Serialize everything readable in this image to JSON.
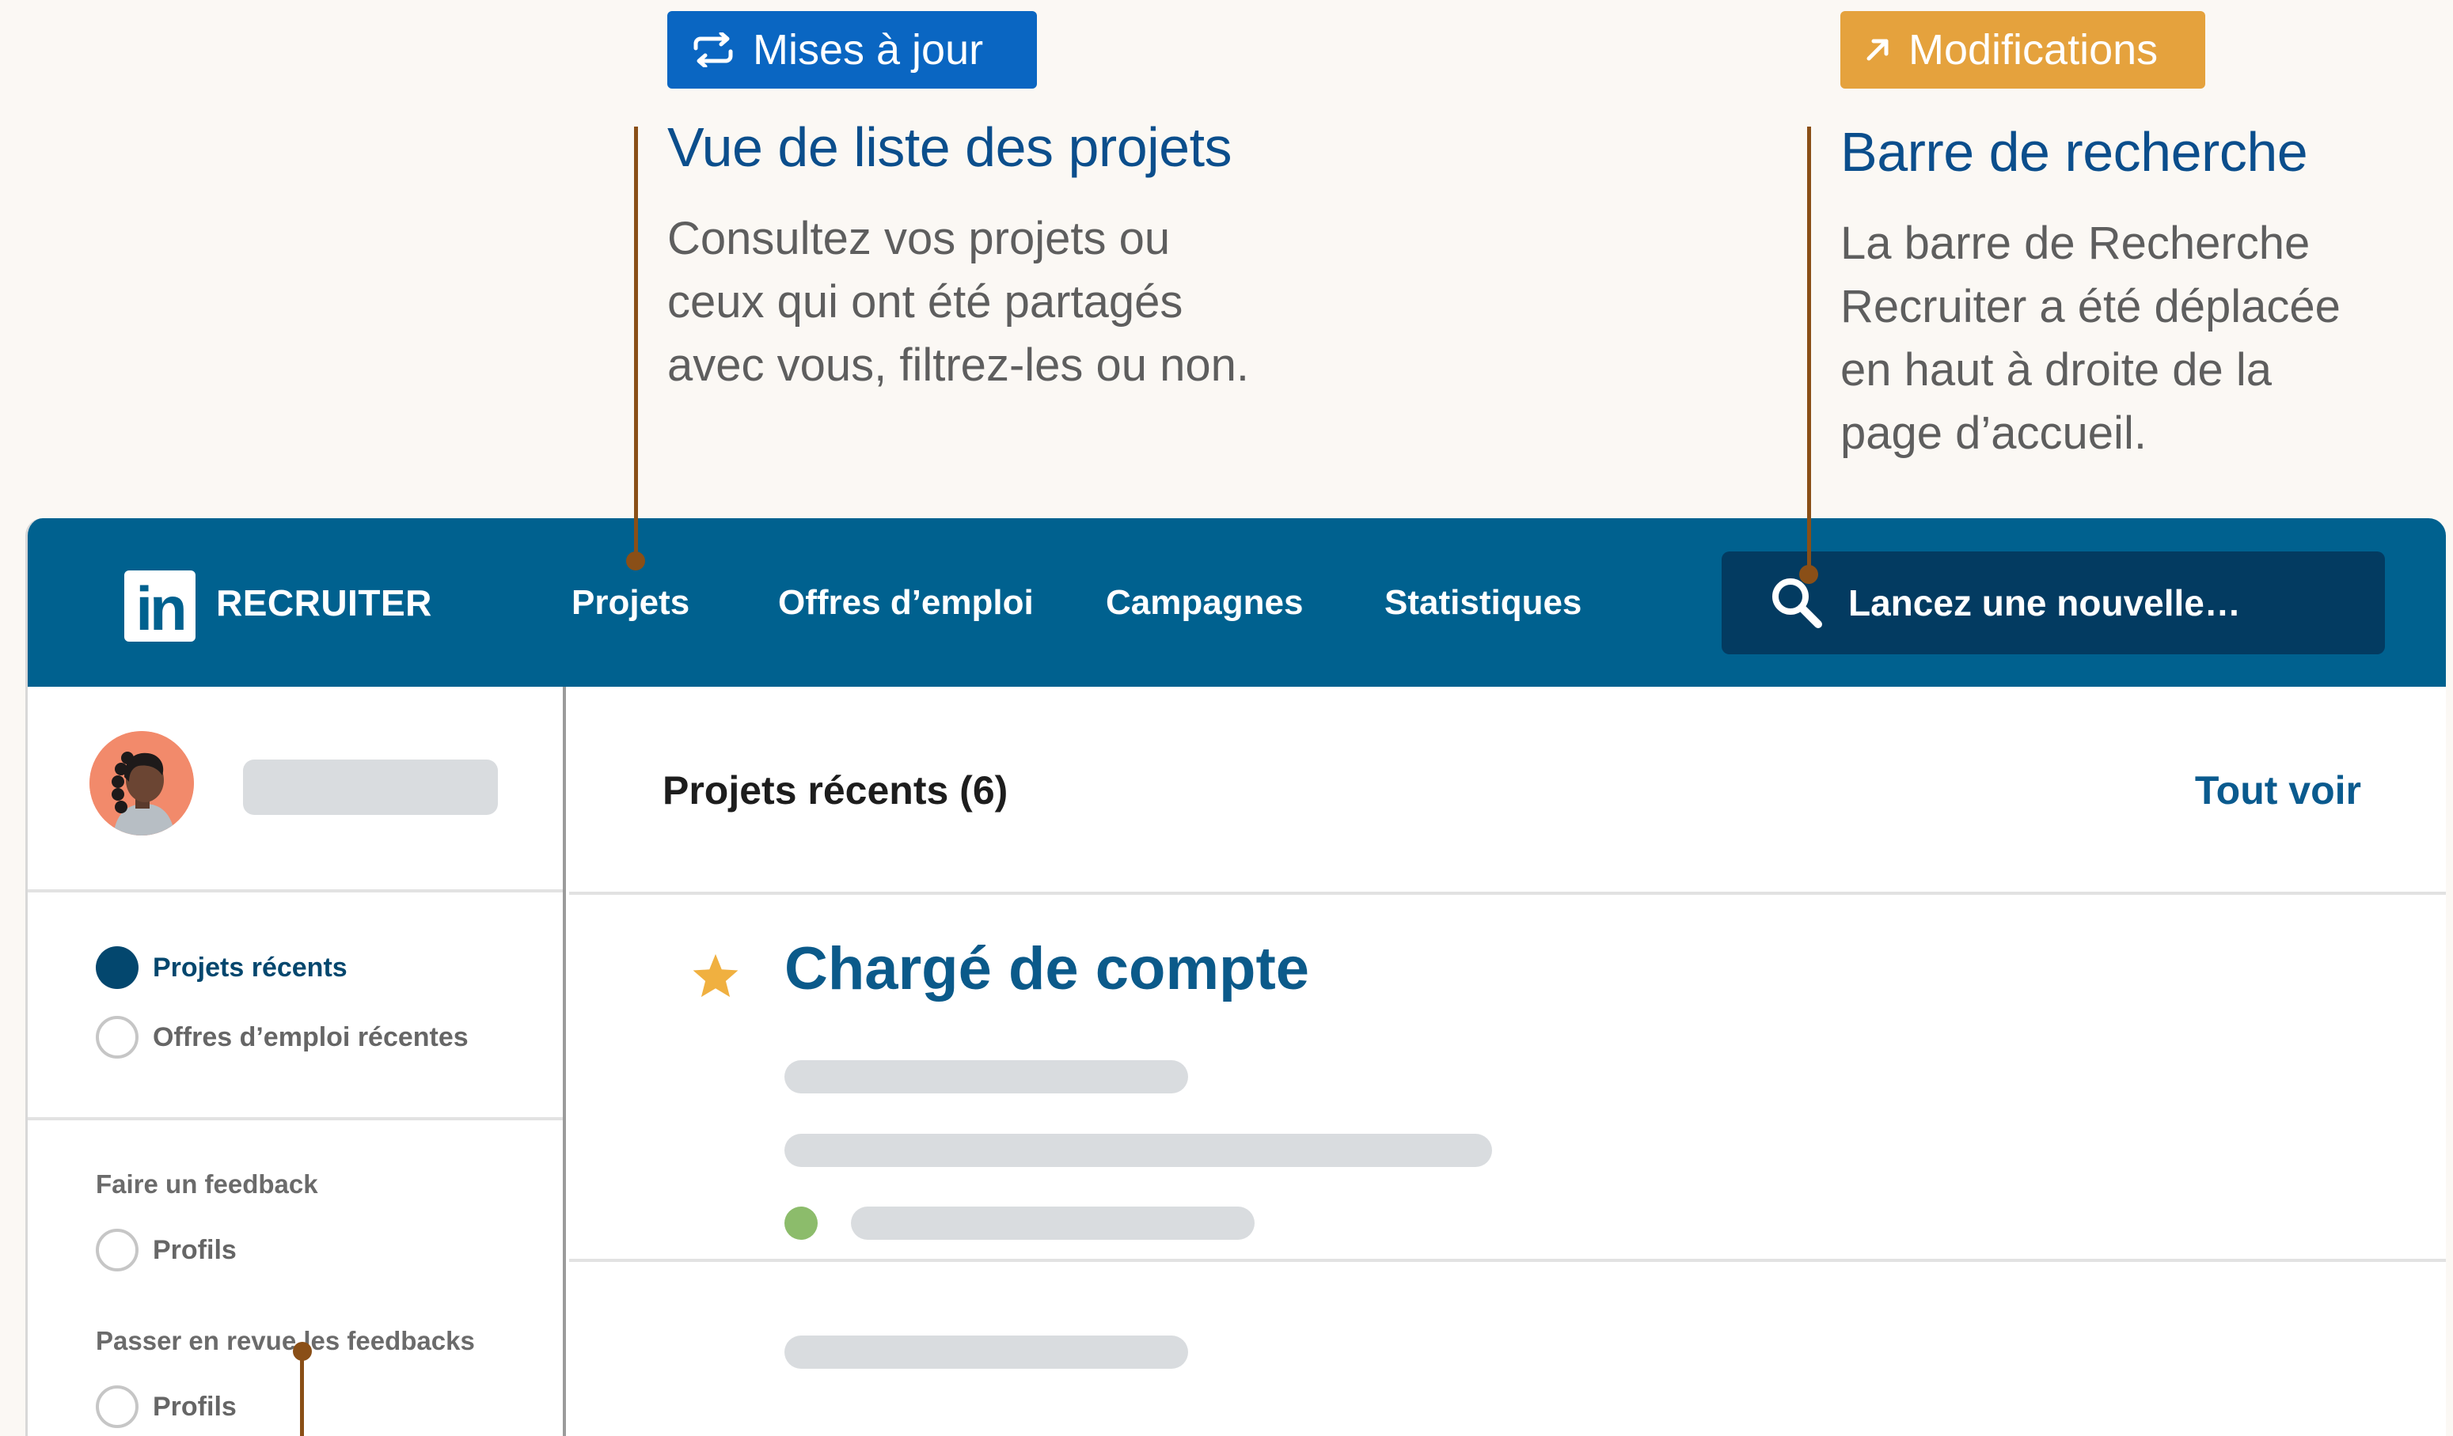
{
  "callouts": {
    "updates": {
      "badge_label": "Mises à jour",
      "badge_color": "#0a66c2",
      "badge_icon": "refresh-arrows-icon",
      "title": "Vue de liste des projets",
      "text_lines": [
        "Consultez vos projets ou",
        "ceux qui ont été partagés",
        "avec vous, filtrez-les ou non."
      ]
    },
    "changes": {
      "badge_label": "Modifications",
      "badge_color": "#e5a23d",
      "badge_icon": "arrow-up-right-icon",
      "title": "Barre de recherche",
      "text_lines": [
        "La barre de Recherche",
        "Recruiter a été déplacée",
        "en haut à droite de la",
        "page d’accueil."
      ]
    }
  },
  "app": {
    "logo_text": "in",
    "brand": "RECRUITER",
    "nav": {
      "projects": "Projets",
      "jobs": "Offres d’emploi",
      "campaigns": "Campagnes",
      "stats": "Statistiques"
    },
    "search": {
      "placeholder": "Lancez une nouvelle…",
      "icon": "search-icon"
    },
    "colors": {
      "nav_background": "#00618f",
      "search_background": "#033b61",
      "accent": "#0b5a8a"
    }
  },
  "sidebar": {
    "filters": [
      {
        "label": "Projets récents",
        "checked": true
      },
      {
        "label": "Offres d’emploi récentes",
        "checked": false
      }
    ],
    "feedback_heading": "Faire un feedback",
    "feedback_item": "Profils",
    "review_heading": "Passer en revue les feedbacks",
    "review_item": "Profils"
  },
  "main": {
    "section_title": "Projets récents (6)",
    "see_all": "Tout voir",
    "project": {
      "title": "Chargé de compte",
      "starred": true,
      "status_color": "#8cbc6b"
    }
  }
}
